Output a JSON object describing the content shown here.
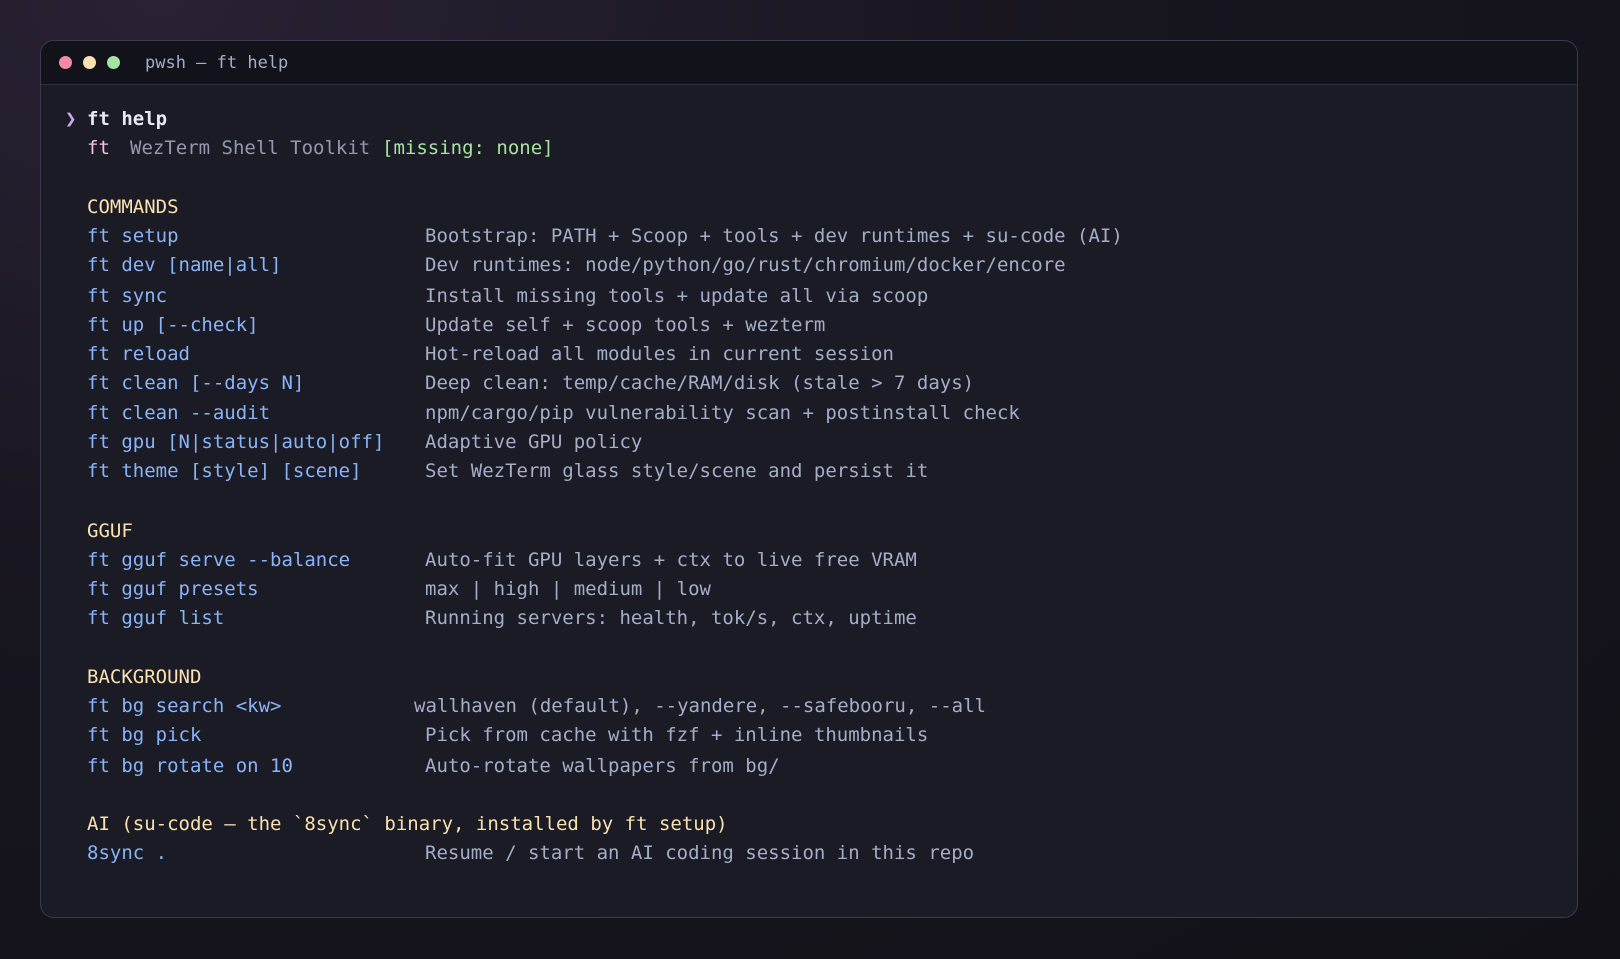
{
  "window": {
    "title": "pwsh — ft help"
  },
  "prompt": {
    "symbol": "❯",
    "command": "ft help"
  },
  "banner": {
    "name": "ft",
    "subtitle": "WezTerm Shell Toolkit",
    "status": "[missing: none]"
  },
  "sections": {
    "commands": {
      "header": "COMMANDS",
      "rows": [
        {
          "cmd": "ft setup",
          "desc": "Bootstrap: PATH + Scoop + tools + dev runtimes + su-code (AI)"
        },
        {
          "cmd": "ft dev [name|all]",
          "desc": "Dev runtimes: node/python/go/rust/chromium/docker/encore"
        },
        {
          "cmd": "ft sync",
          "desc": "Install missing tools + update all via scoop"
        },
        {
          "cmd": "ft up [--check]",
          "desc": "Update self + scoop tools + wezterm"
        },
        {
          "cmd": "ft reload",
          "desc": "Hot-reload all modules in current session"
        },
        {
          "cmd": "ft clean [--days N]",
          "desc": "Deep clean: temp/cache/RAM/disk (stale > 7 days)"
        },
        {
          "cmd": "ft clean --audit",
          "desc": "npm/cargo/pip vulnerability scan + postinstall check"
        },
        {
          "cmd": "ft gpu [N|status|auto|off]",
          "desc": "Adaptive GPU policy"
        },
        {
          "cmd": "ft theme [style] [scene]",
          "desc": "Set WezTerm glass style/scene and persist it"
        }
      ]
    },
    "gguf": {
      "header": "GGUF",
      "rows": [
        {
          "cmd": "ft gguf serve --balance",
          "desc": "Auto-fit GPU layers + ctx to live free VRAM"
        },
        {
          "cmd": "ft gguf presets",
          "desc": "max | high | medium | low"
        },
        {
          "cmd": "ft gguf list",
          "desc": "Running servers: health, tok/s, ctx, uptime"
        }
      ]
    },
    "background": {
      "header": "BACKGROUND",
      "rows": [
        {
          "cmd": "ft bg search <kw>",
          "desc": "wallhaven (default), --yandere, --safebooru, --all"
        },
        {
          "cmd": "ft bg pick",
          "desc": "Pick from cache with fzf + inline thumbnails"
        },
        {
          "cmd": "ft bg rotate on 10",
          "desc": "Auto-rotate wallpapers from bg/"
        }
      ]
    },
    "ai": {
      "header": "AI (su-code — the `8sync` binary, installed by ft setup)",
      "rows": [
        {
          "cmd": "8sync .",
          "desc": "Resume / start an AI coding session in this repo"
        }
      ]
    }
  }
}
